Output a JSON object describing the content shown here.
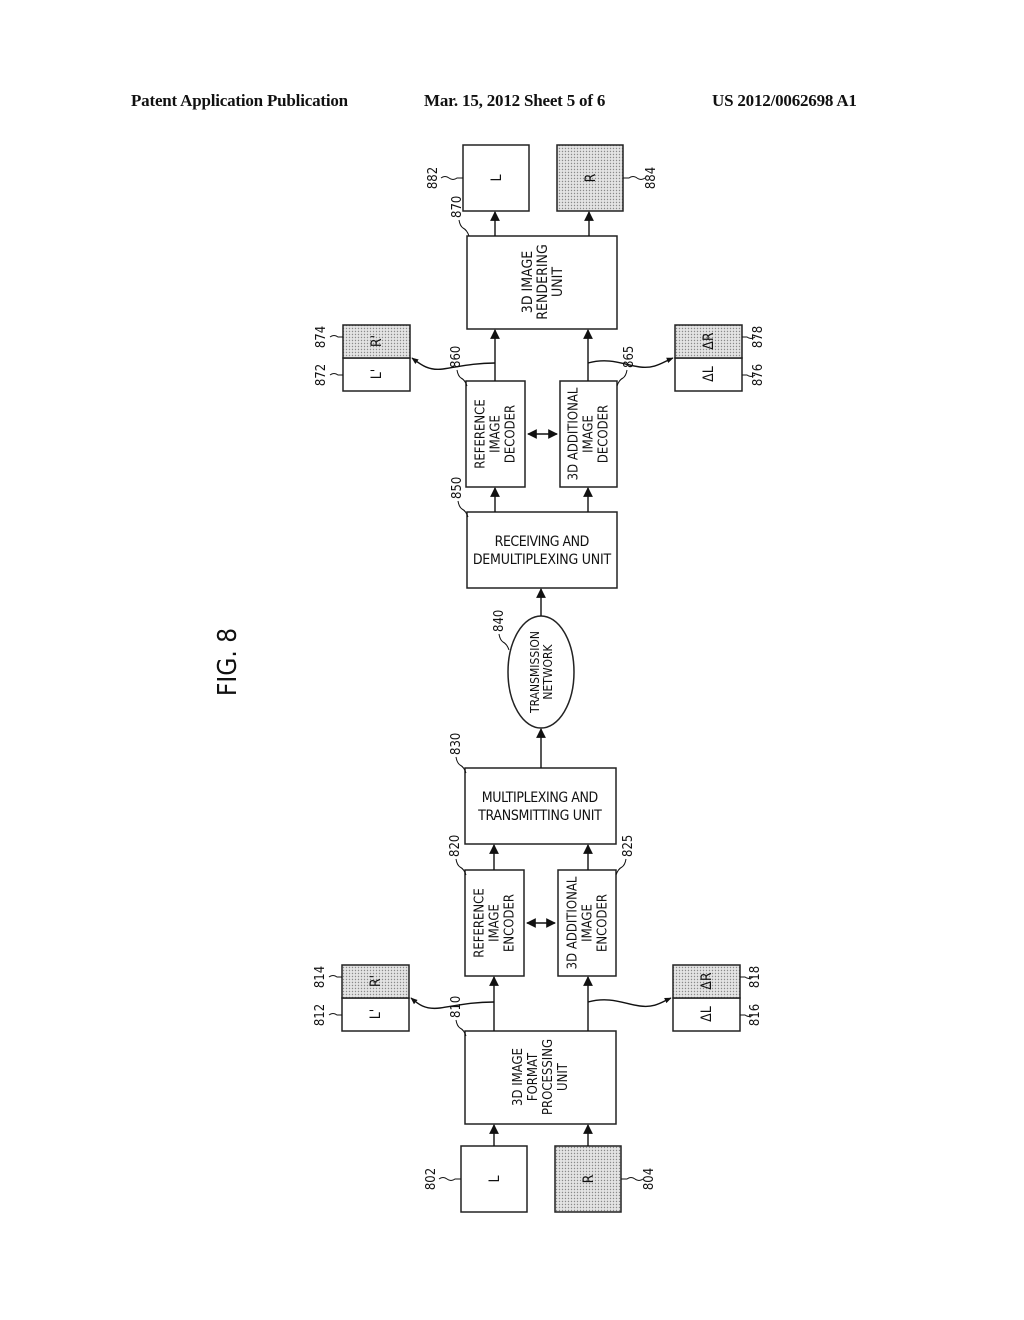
{
  "header": {
    "publication": "Patent Application Publication",
    "date_sheet": "Mar. 15, 2012  Sheet 5 of 6",
    "number": "US 2012/0062698 A1"
  },
  "figure": {
    "label": "FIG. 8"
  },
  "nodes": {
    "n802": {
      "ref": "802",
      "label": "L"
    },
    "n804": {
      "ref": "804",
      "label": "R"
    },
    "n810": {
      "ref": "810",
      "lines": [
        "3D IMAGE",
        "FORMAT",
        "PROCESSING",
        "UNIT"
      ]
    },
    "n812": {
      "ref": "812",
      "label": "L'"
    },
    "n814": {
      "ref": "814",
      "label": "R'"
    },
    "n816": {
      "ref": "816",
      "label": "ΔL"
    },
    "n818": {
      "ref": "818",
      "label": "ΔR"
    },
    "n820": {
      "ref": "820",
      "lines": [
        "REFERENCE",
        "IMAGE",
        "ENCODER"
      ]
    },
    "n825": {
      "ref": "825",
      "lines": [
        "3D ADDITIONAL",
        "IMAGE",
        "ENCODER"
      ]
    },
    "n830": {
      "ref": "830",
      "lines": [
        "MULTIPLEXING AND",
        "TRANSMITTING UNIT"
      ]
    },
    "n840": {
      "ref": "840",
      "lines": [
        "TRANSMISSION",
        "NETWORK"
      ]
    },
    "n850": {
      "ref": "850",
      "lines": [
        "RECEIVING AND",
        "DEMULTIPLEXING UNIT"
      ]
    },
    "n860": {
      "ref": "860",
      "lines": [
        "REFERENCE",
        "IMAGE",
        "DECODER"
      ]
    },
    "n865": {
      "ref": "865",
      "lines": [
        "3D ADDITIONAL",
        "IMAGE",
        "DECODER"
      ]
    },
    "n870": {
      "ref": "870",
      "lines": [
        "3D IMAGE",
        "RENDERING",
        "UNIT"
      ]
    },
    "n872": {
      "ref": "872",
      "label": "L'"
    },
    "n874": {
      "ref": "874",
      "label": "R'"
    },
    "n876": {
      "ref": "876",
      "label": "ΔL"
    },
    "n878": {
      "ref": "878",
      "label": "ΔR"
    },
    "n882": {
      "ref": "882",
      "label": "L"
    },
    "n884": {
      "ref": "884",
      "label": "R"
    }
  },
  "colors": {
    "stroke": "#222222",
    "shade": "#d6d6d6",
    "paper": "#ffffff"
  }
}
